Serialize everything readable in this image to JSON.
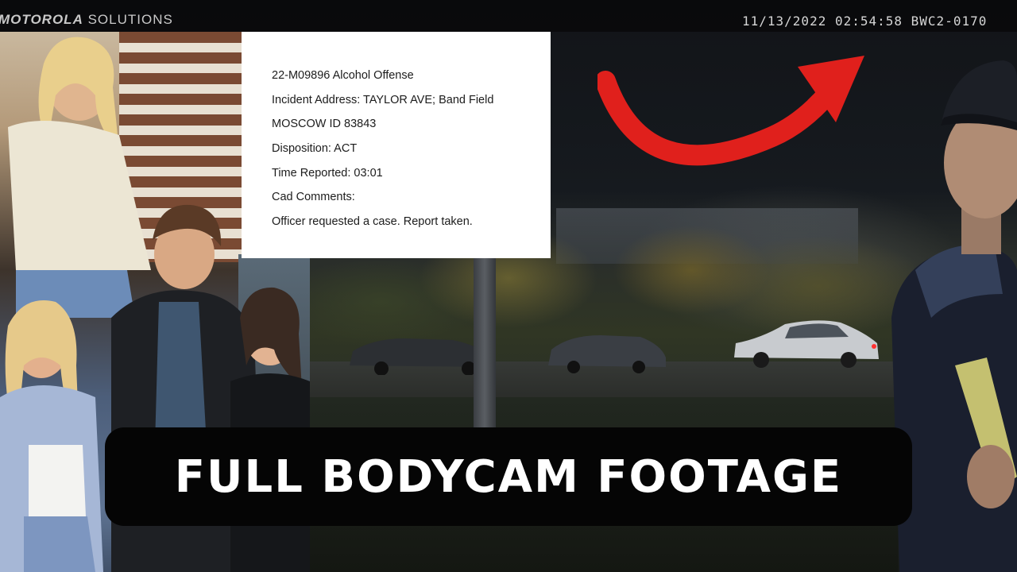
{
  "header": {
    "brand_bold": "MOTOROLA",
    "brand_rest": " SOLUTIONS",
    "timestamp": "11/13/2022 02:54:58 BWC2-0170"
  },
  "document": {
    "lines": [
      "22-M09896 Alcohol Offense",
      "Incident Address: TAYLOR AVE; Band Field",
      "MOSCOW ID 83843",
      "Disposition: ACT",
      "Time Reported: 03:01",
      "Cad Comments:",
      "Officer requested a case. Report taken."
    ]
  },
  "caption": {
    "text": "FULL BODYCAM FOOTAGE"
  },
  "colors": {
    "arrow": "#e0201c",
    "caption_bg": "#050505",
    "caption_text": "#ffffff"
  }
}
